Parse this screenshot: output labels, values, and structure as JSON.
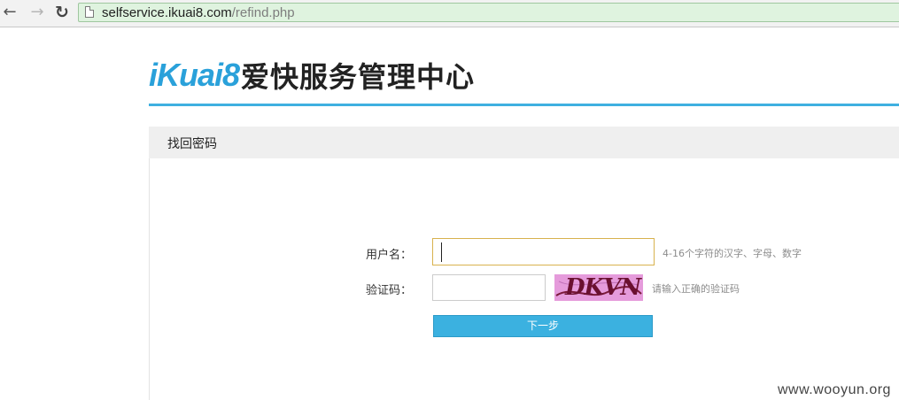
{
  "browser": {
    "url_host": "selfservice.ikuai8.com",
    "url_path": "/refind.php",
    "back_icon": "arrow-left-icon",
    "forward_icon": "arrow-right-icon",
    "reload_icon": "reload-icon"
  },
  "header": {
    "logo_mark": "iKuai8",
    "logo_title": "爱快服务管理中心",
    "brand_color": "#2aa1da"
  },
  "panel": {
    "title": "找回密码"
  },
  "form": {
    "username_label": "用户名：",
    "username_value": "",
    "username_hint": "4-16个字符的汉字、字母、数字",
    "captcha_label": "验证码：",
    "captcha_value": "",
    "captcha_image_text": "DKVN",
    "captcha_hint": "请输入正确的验证码",
    "next_button": "下一步"
  },
  "watermark": "www.wooyun.org"
}
